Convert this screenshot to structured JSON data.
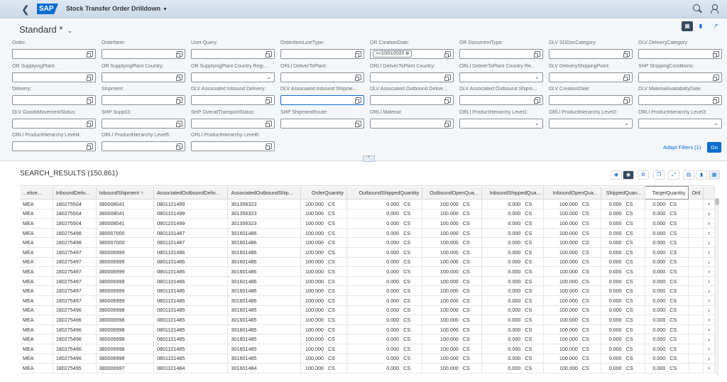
{
  "shell": {
    "title": "Stock Transfer Order Drilldown",
    "logo": "SAP"
  },
  "header": {
    "variant": "Standard *"
  },
  "filters": [
    {
      "label": "Order:",
      "type": "vh"
    },
    {
      "label": "OrderItem:",
      "type": "vh"
    },
    {
      "label": "User Query:",
      "type": "vh"
    },
    {
      "label": "OrderItemLineType:",
      "type": "vh"
    },
    {
      "label": "OR CreationDate:",
      "type": "vh",
      "token": ">=10/01/2020"
    },
    {
      "label": "OR DocumentType:",
      "type": "vh"
    },
    {
      "label": "DLV SDDocCategory:",
      "type": "vh"
    },
    {
      "label": "DLV DeliveryCategory:",
      "type": "vh"
    },
    {
      "label": "OR SupplyingPlant:",
      "type": "vh"
    },
    {
      "label": "OR SupplyingPlant Country:",
      "type": "vh"
    },
    {
      "label": "OR SupplyingPlant Country Regi...",
      "type": "dd"
    },
    {
      "label": "ORLI DeliverToPlant:",
      "type": "vh"
    },
    {
      "label": "ORLI DeliverToPlant Country:",
      "type": "vh"
    },
    {
      "label": "ORLI DeliverToPlant Country Re...",
      "type": "dd"
    },
    {
      "label": "DLV DeliveryShippingPoint:",
      "type": "vh"
    },
    {
      "label": "SHP ShippingConditions:",
      "type": "vh"
    },
    {
      "label": "Delivery:",
      "type": "vh"
    },
    {
      "label": "Shipment:",
      "type": "vh"
    },
    {
      "label": "DLV Associated Inbound Delivery:",
      "type": "vh"
    },
    {
      "label": "DLV Associated Inbound Shipme...",
      "type": "vh",
      "active": true
    },
    {
      "label": "DLV Associated Outbound Delive...",
      "type": "vh"
    },
    {
      "label": "DLV Associated Outbound Shipm...",
      "type": "vh"
    },
    {
      "label": "DLV CreationDate:",
      "type": "vh"
    },
    {
      "label": "DLV MaterialAvailabilityDate:",
      "type": "vh"
    },
    {
      "label": "DLV GoodsMovementStatus:",
      "type": "vh"
    },
    {
      "label": "SHP SupplI3:",
      "type": "vh"
    },
    {
      "label": "SHP OverallTransportStatus:",
      "type": "vh"
    },
    {
      "label": "SHP ShipmentRoute:",
      "type": "vh"
    },
    {
      "label": "ORLI Material:",
      "type": "vh"
    },
    {
      "label": "ORLI ProductHierarchy Level1:",
      "type": "dd"
    },
    {
      "label": "ORLI ProductHierarchy Level2:",
      "type": "dd"
    },
    {
      "label": "ORLI ProductHierarchy Level3:",
      "type": "dd"
    },
    {
      "label": "ORLI ProductHierarchy Level4:",
      "type": "vh"
    },
    {
      "label": "ORLI ProductHierarchy Level5:",
      "type": "vh"
    },
    {
      "label": "ORLI ProductHierarchy Level6:",
      "type": "vh"
    }
  ],
  "filterbar": {
    "adapt": "Adapt Filters (1)",
    "go": "Go"
  },
  "results": {
    "title": "SEARCH_RESULTS (150,861)",
    "columns": [
      "...elive...",
      "InboundDeliv...",
      "InboundShipment",
      "AssociatedOutboundDeliv...",
      "AssociatedOutboundShip...",
      "OrderQuantity",
      "OutboundShippedQuantity",
      "OutboundOpenQua...",
      "InboundShippedQua...",
      "InboundOpenQua...",
      "ShippedQuan...",
      "TargetQuantity",
      "Ord"
    ],
    "unit": "CS",
    "rows": [
      [
        "MEA",
        "180275504",
        "380008041",
        "0801101499",
        "301356323",
        "100.000",
        "0.000",
        "100.000",
        "0.000",
        "100.000",
        "0.000",
        "0.000"
      ],
      [
        "MEA",
        "180275504",
        "380008041",
        "0801101499",
        "301356323",
        "100.000",
        "0.000",
        "100.000",
        "0.000",
        "100.000",
        "0.000",
        "0.000"
      ],
      [
        "MEA",
        "180275504",
        "380008041",
        "0801101499",
        "301356323",
        "100.000",
        "0.000",
        "100.000",
        "0.000",
        "100.000",
        "0.000",
        "0.000"
      ],
      [
        "MEA",
        "180275498",
        "380007000",
        "0801101487",
        "301601486",
        "100.000",
        "0.000",
        "100.000",
        "0.000",
        "100.000",
        "0.000",
        "0.000"
      ],
      [
        "MEA",
        "180275498",
        "380007000",
        "0801101487",
        "301601486",
        "100.000",
        "0.000",
        "100.000",
        "0.000",
        "100.000",
        "0.000",
        "0.000"
      ],
      [
        "MEA",
        "180275497",
        "380006999",
        "0801101486",
        "301601486",
        "100.000",
        "0.000",
        "100.000",
        "0.000",
        "100.000",
        "0.000",
        "0.000"
      ],
      [
        "MEA",
        "180275497",
        "380006999",
        "0801101486",
        "301601486",
        "100.000",
        "0.000",
        "100.000",
        "0.000",
        "100.000",
        "0.000",
        "0.000"
      ],
      [
        "MEA",
        "180275497",
        "380006999",
        "0801101486",
        "301601486",
        "100.000",
        "0.000",
        "100.000",
        "0.000",
        "100.000",
        "0.000",
        "0.000"
      ],
      [
        "MEA",
        "180275497",
        "380006999",
        "0801101486",
        "301601486",
        "100.000",
        "0.000",
        "100.000",
        "0.000",
        "100.000",
        "0.000",
        "0.000"
      ],
      [
        "MEA",
        "180275497",
        "380006999",
        "0801101486",
        "301601486",
        "100.000",
        "0.000",
        "100.000",
        "0.000",
        "100.000",
        "0.000",
        "0.000"
      ],
      [
        "MEA",
        "180275497",
        "380006999",
        "0801101486",
        "301601486",
        "100.000",
        "0.000",
        "100.000",
        "0.000",
        "100.000",
        "0.000",
        "0.000"
      ],
      [
        "MEA",
        "180275496",
        "380006998",
        "0801101485",
        "301601485",
        "100.000",
        "0.000",
        "100.000",
        "0.000",
        "100.000",
        "0.000",
        "0.000"
      ],
      [
        "MEA",
        "180275496",
        "380006998",
        "0801101485",
        "301601485",
        "100.000",
        "0.000",
        "100.000",
        "0.000",
        "100.000",
        "0.000",
        "0.000"
      ],
      [
        "MEA",
        "180275496",
        "380006998",
        "0801101485",
        "301601485",
        "100.000",
        "0.000",
        "100.000",
        "0.000",
        "100.000",
        "0.000",
        "0.000"
      ],
      [
        "MEA",
        "180275496",
        "380006998",
        "0801101485",
        "301601485",
        "100.000",
        "0.000",
        "100.000",
        "0.000",
        "100.000",
        "0.000",
        "0.000"
      ],
      [
        "MEA",
        "180275496",
        "380006998",
        "0801101485",
        "301601485",
        "100.000",
        "0.000",
        "100.000",
        "0.000",
        "100.000",
        "0.000",
        "0.000"
      ],
      [
        "MEA",
        "180275496",
        "380006998",
        "0801101485",
        "301601485",
        "100.000",
        "0.000",
        "100.000",
        "0.000",
        "100.000",
        "0.000",
        "0.000"
      ],
      [
        "MEA",
        "180275495",
        "380006997",
        "0801101484",
        "301601484",
        "100.000",
        "0.000",
        "100.000",
        "0.000",
        "100.000",
        "0.000",
        "0.000"
      ]
    ]
  },
  "colors": {
    "accent": "#0a6ed1",
    "shell": "#dfe8f2",
    "header": "#f4f6f9"
  }
}
